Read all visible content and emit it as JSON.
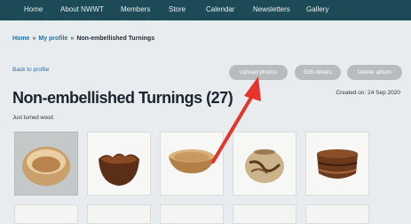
{
  "nav": {
    "items": [
      "Home",
      "About NWWT",
      "Members",
      "Store",
      "Calendar",
      "Newsletters",
      "Gallery"
    ]
  },
  "breadcrumb": {
    "home": "Home",
    "profile": "My profile",
    "current": "Non-embellished Turnings",
    "separator": "»"
  },
  "actions": {
    "back": "Back to profile",
    "upload": "Upload photos",
    "edit": "Edit details",
    "delete": "Delete album"
  },
  "album": {
    "title": "Non-embellished Turnings (27)",
    "created": "Created on: 24 Sep 2020",
    "description": "Just turned wood."
  },
  "colors": {
    "nav_bg": "#1c4a56",
    "link": "#2a6fa0",
    "button_bg": "#b7bcbf",
    "arrow": "#e3352b"
  },
  "thumbnails": [
    "bowl-light-wood",
    "bowl-natural-edge-dark",
    "shallow-dish-light",
    "bowl-spalted",
    "bowl-dark-striped"
  ]
}
